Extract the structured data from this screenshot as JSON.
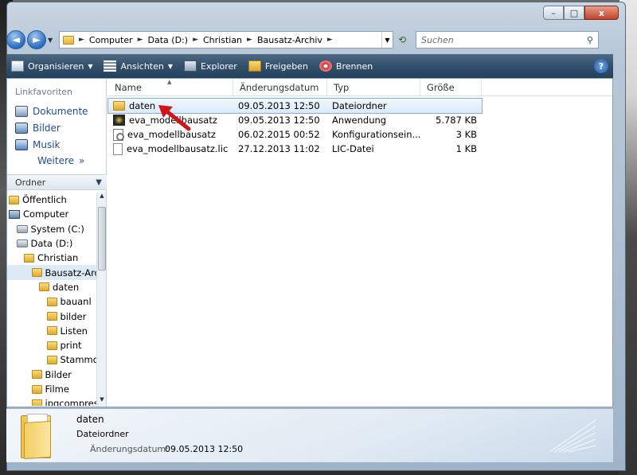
{
  "window": {
    "minimize": "–",
    "maximize": "□",
    "close": "x"
  },
  "address": {
    "back": "◄",
    "forward": "►",
    "segments": [
      "Computer",
      "Data (D:)",
      "Christian",
      "Bausatz-Archiv"
    ],
    "search_placeholder": "Suchen"
  },
  "toolbar": {
    "organize": "Organisieren",
    "views": "Ansichten",
    "explorer": "Explorer",
    "share": "Freigeben",
    "burn": "Brennen",
    "help": "?"
  },
  "nav_pane": {
    "favorites_header": "Linkfavoriten",
    "links": [
      "Dokumente",
      "Bilder",
      "Musik"
    ],
    "more": "Weitere",
    "folders_header": "Ordner",
    "tree": [
      {
        "label": "Öffentlich",
        "indent": 0
      },
      {
        "label": "Computer",
        "indent": 0
      },
      {
        "label": "System (C:)",
        "indent": 1
      },
      {
        "label": "Data (D:)",
        "indent": 1
      },
      {
        "label": "Christian",
        "indent": 2
      },
      {
        "label": "Bausatz-Arch",
        "indent": 3
      },
      {
        "label": "daten",
        "indent": 4
      },
      {
        "label": "bauanl",
        "indent": 5
      },
      {
        "label": "bilder",
        "indent": 5
      },
      {
        "label": "Listen",
        "indent": 5
      },
      {
        "label": "print",
        "indent": 5
      },
      {
        "label": "Stammd",
        "indent": 5
      },
      {
        "label": "Bilder",
        "indent": 3
      },
      {
        "label": "Filme",
        "indent": 3
      },
      {
        "label": "jpgcompres",
        "indent": 3
      }
    ]
  },
  "columns": {
    "name": "Name",
    "date": "Änderungsdatum",
    "type": "Typ",
    "size": "Größe"
  },
  "files": [
    {
      "name": "daten",
      "date": "09.05.2013 12:50",
      "type": "Dateiordner",
      "size": "",
      "icon": "folder-icon"
    },
    {
      "name": "eva_modellbausatz",
      "date": "09.05.2013 12:50",
      "type": "Anwendung",
      "size": "5.787 KB",
      "icon": "application-icon"
    },
    {
      "name": "eva_modellbausatz",
      "date": "06.02.2015 00:52",
      "type": "Konfigurationsein...",
      "size": "3 KB",
      "icon": "config-file-icon"
    },
    {
      "name": "eva_modellbausatz.lic",
      "date": "27.12.2013 11:02",
      "type": "LIC-Datei",
      "size": "1 KB",
      "icon": "document-icon"
    }
  ],
  "details": {
    "name": "daten",
    "type": "Dateiordner",
    "date_label": "Änderungsdatum:",
    "date_value": "09.05.2013 12:50"
  },
  "colors": {
    "toolbar": "#32506c",
    "link": "#1f4e8e",
    "selection": "#d9eafb",
    "annotation_arrow": "#d0141a"
  }
}
